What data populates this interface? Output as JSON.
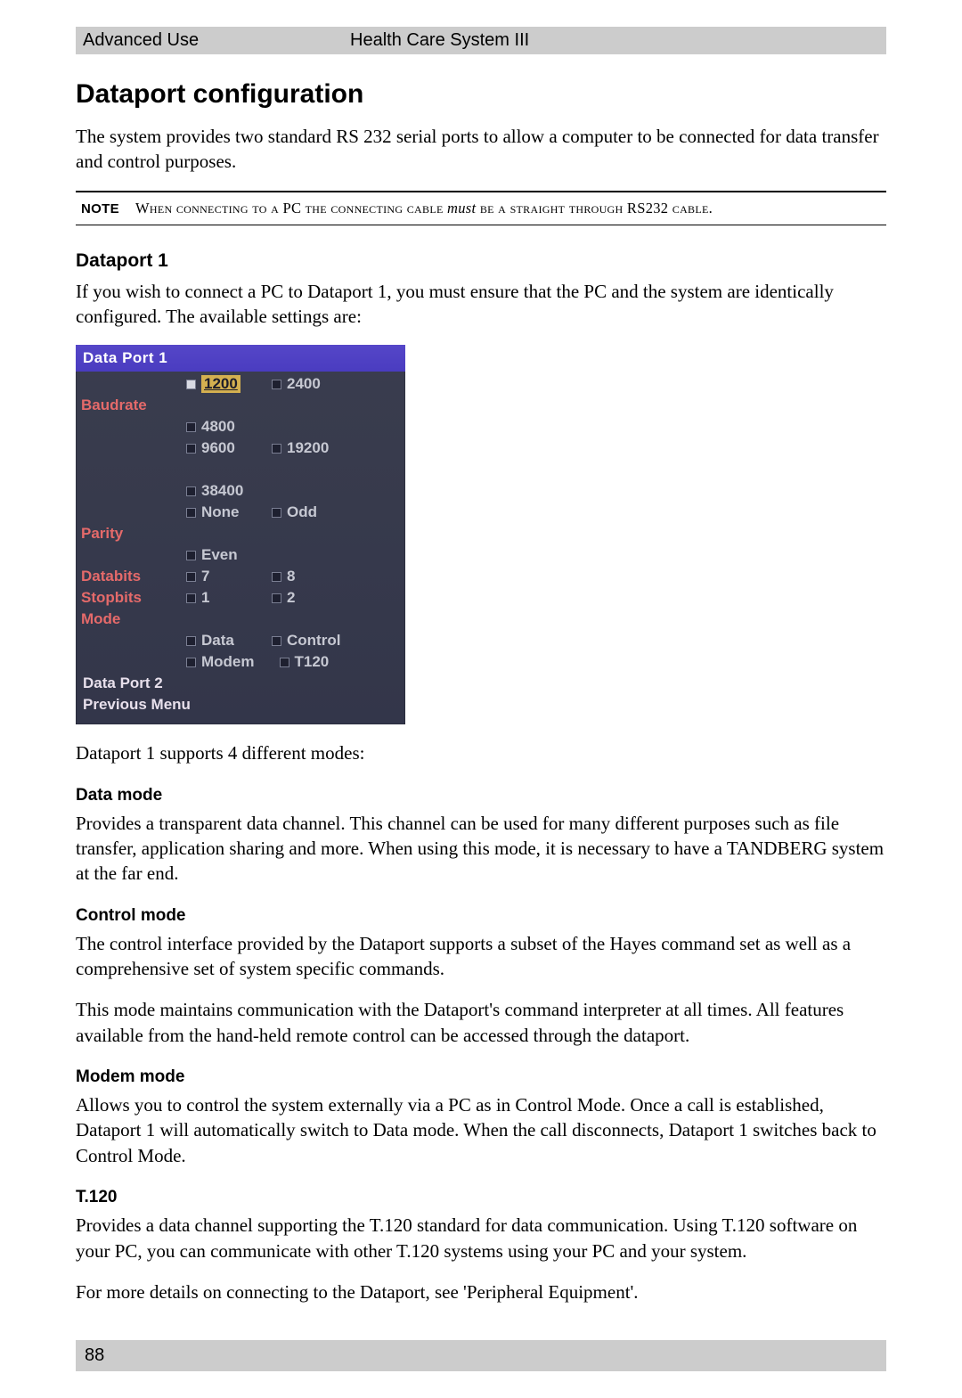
{
  "header": {
    "left": "Advanced Use",
    "center": "Health Care System III"
  },
  "title": "Dataport configuration",
  "intro": "The system provides two standard RS 232 serial ports to allow a computer to be connected for data transfer and control purposes.",
  "note": {
    "label": "NOTE",
    "pre": "When connecting to a PC the connecting cable ",
    "em": "must",
    "post": " be a straight through RS232 cable."
  },
  "dp1": {
    "heading": "Dataport 1",
    "intro": "If you wish to connect a PC to Dataport 1, you must ensure that the PC and the system are identically configured. The available settings are:"
  },
  "osd": {
    "title": "Data Port 1",
    "rows": [
      {
        "label": "Baudrate",
        "options": [
          {
            "val": "1200",
            "selected": true
          },
          {
            "val": "2400"
          },
          {
            "val": "4800"
          }
        ]
      },
      {
        "label": "",
        "options": [
          {
            "val": "9600"
          },
          {
            "val": "19200"
          },
          {
            "val": "38400"
          }
        ]
      },
      {
        "label": "Parity",
        "options": [
          {
            "val": "None"
          },
          {
            "val": "Odd"
          },
          {
            "val": "Even"
          }
        ]
      },
      {
        "label": "Databits",
        "options": [
          {
            "val": "7"
          },
          {
            "val": "8"
          }
        ]
      },
      {
        "label": "Stopbits",
        "options": [
          {
            "val": "1"
          },
          {
            "val": "2"
          }
        ]
      },
      {
        "label": "Mode",
        "options": []
      },
      {
        "label": "",
        "options": [
          {
            "val": "Data"
          },
          {
            "val": "Control"
          }
        ]
      },
      {
        "label": "",
        "options": [
          {
            "val": "Modem"
          },
          {
            "val": "T120"
          }
        ]
      }
    ],
    "links": [
      "Data Port 2",
      "Previous Menu"
    ]
  },
  "after_osd": "Dataport 1 supports 4 different modes:",
  "modes": {
    "data": {
      "h": "Data mode",
      "p": "Provides a transparent data channel. This channel can be used for many different purposes such as file transfer, application sharing and more. When using this mode, it is necessary to have a TANDBERG system at the far end."
    },
    "control": {
      "h": "Control mode",
      "p1": "The control interface provided by the Dataport supports a subset of the Hayes command set as well as a comprehensive set of system specific commands.",
      "p2": "This mode maintains communication with the Dataport's command interpreter at all times. All features available from the hand-held remote control can be accessed through the dataport."
    },
    "modem": {
      "h": "Modem mode",
      "p": "Allows you to control the system externally via a PC as in Control Mode. Once a call is established, Dataport 1 will automatically switch to Data mode. When the call disconnects, Dataport 1 switches back to Control Mode."
    },
    "t120": {
      "h": "T.120",
      "p1": "Provides a data channel supporting the T.120 standard for data communication. Using T.120 software on your PC, you can communicate with other T.120 systems using your PC and your system.",
      "p2": "For more details on connecting to the Dataport, see 'Peripheral Equipment'."
    }
  },
  "page_number": "88"
}
